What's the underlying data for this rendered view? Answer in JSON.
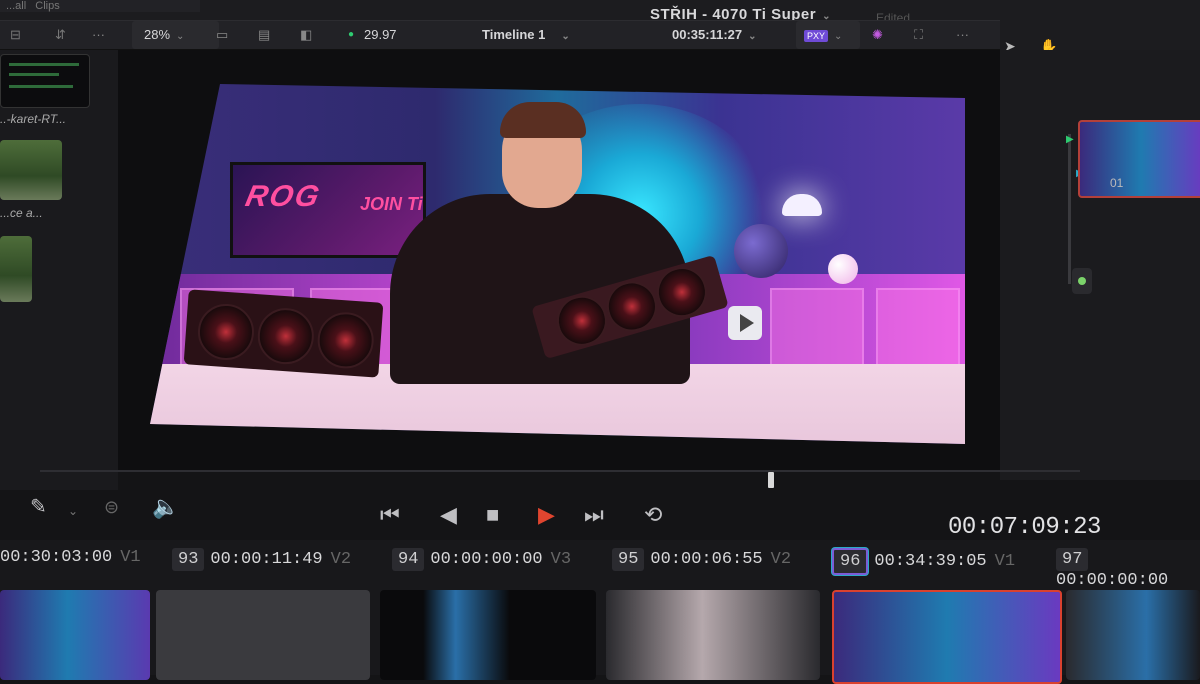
{
  "menubar": {
    "items": [
      "...all",
      "Clips"
    ]
  },
  "project": {
    "title": "STŘIH - 4070 Ti Super",
    "status": "Edited"
  },
  "toolbar": {
    "zoom": "28%",
    "fps": "29.97",
    "timeline_name": "Timeline 1",
    "timecode": "00:35:11:27",
    "proxy_badge": "PXY"
  },
  "media_pool": {
    "items": [
      {
        "name": "..-karet-RT..."
      },
      {
        "name": "...ce a..."
      }
    ]
  },
  "video_frame": {
    "monitor_text": "ROG",
    "monitor_sub": "JOIN Ti"
  },
  "right_panel": {
    "clip_label": "01"
  },
  "transport": {
    "timecode": "00:07:09:23",
    "playhead_fraction": 0.7
  },
  "clips": [
    {
      "num": "",
      "tc": "00:30:03:00",
      "track": "V1"
    },
    {
      "num": "93",
      "tc": "00:00:11:49",
      "track": "V2"
    },
    {
      "num": "94",
      "tc": "00:00:00:00",
      "track": "V3"
    },
    {
      "num": "95",
      "tc": "00:00:06:55",
      "track": "V2"
    },
    {
      "num": "96",
      "tc": "00:34:39:05",
      "track": "V1"
    },
    {
      "num": "97",
      "tc": "00:00:00:00",
      "track": ""
    }
  ],
  "colors": {
    "accent_red": "#d9412f",
    "accent_green": "#2ecc71",
    "selection_orange": "#b3403a"
  }
}
